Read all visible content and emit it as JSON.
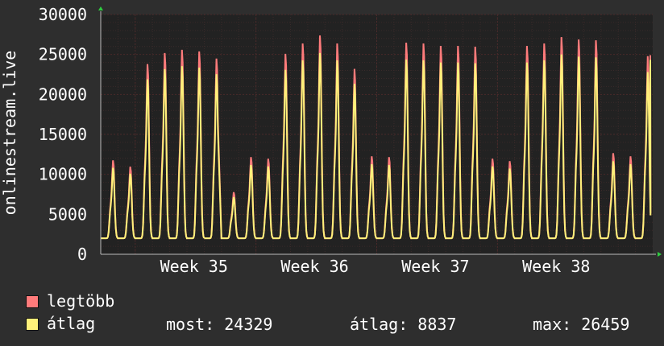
{
  "chart_data": {
    "type": "line",
    "ylabel": "onlinestream.live",
    "ylim": [
      0,
      30000
    ],
    "yticks": [
      0,
      5000,
      10000,
      15000,
      20000,
      25000,
      30000
    ],
    "xtick_labels": [
      "Week 35",
      "Week 36",
      "Week 37",
      "Week 38"
    ],
    "grid": true,
    "colors": {
      "background": "#2e2e2e",
      "plot_bg": "#222222",
      "grid_major": "#4a2a2a",
      "grid_minor": "#3a2a2a",
      "max_series": "#ff7b7b",
      "avg_series": "#fff07a"
    },
    "daily_peaks": [
      11800,
      11000,
      23900,
      25300,
      25700,
      25500,
      24600,
      7800,
      12200,
      12000,
      25200,
      26500,
      27500,
      26500,
      23300,
      12300,
      12200,
      26600,
      26500,
      26200,
      26200,
      26100,
      12000,
      11700,
      26200,
      26500,
      27300,
      27000,
      26900,
      12700,
      12300,
      24900
    ],
    "daily_min": 2000,
    "gap_days": [
      6
    ],
    "series": [
      {
        "name": "legtöbb",
        "color": "#ff7b7b"
      },
      {
        "name": "átlag",
        "color": "#fff07a"
      }
    ]
  },
  "legend": {
    "max_label": "legtöbb",
    "avg_label": "átlag",
    "most_text": "most: 24329",
    "avg_text": "átlag: 8837",
    "max_text": "max: 26459"
  }
}
